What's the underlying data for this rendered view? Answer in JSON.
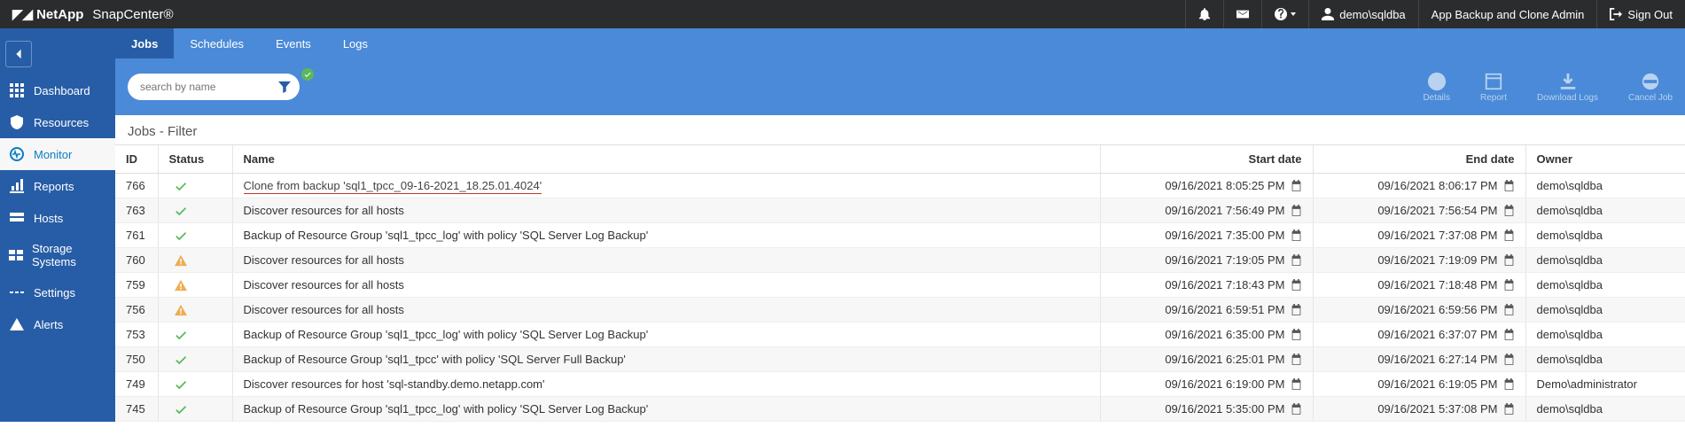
{
  "header": {
    "brand_bold": "NetApp",
    "product": "SnapCenter®",
    "user": "demo\\sqldba",
    "role": "App Backup and Clone Admin",
    "signout": "Sign Out"
  },
  "sidebar": {
    "items": [
      {
        "label": "Dashboard"
      },
      {
        "label": "Resources"
      },
      {
        "label": "Monitor"
      },
      {
        "label": "Reports"
      },
      {
        "label": "Hosts"
      },
      {
        "label": "Storage Systems"
      },
      {
        "label": "Settings"
      },
      {
        "label": "Alerts"
      }
    ]
  },
  "tabs": [
    {
      "label": "Jobs"
    },
    {
      "label": "Schedules"
    },
    {
      "label": "Events"
    },
    {
      "label": "Logs"
    }
  ],
  "search": {
    "placeholder": "search by name"
  },
  "toolbar_actions": [
    {
      "label": "Details"
    },
    {
      "label": "Report"
    },
    {
      "label": "Download Logs"
    },
    {
      "label": "Cancel Job"
    }
  ],
  "filter_title": "Jobs - Filter",
  "columns": {
    "id": "ID",
    "status": "Status",
    "name": "Name",
    "start": "Start date",
    "end": "End date",
    "owner": "Owner"
  },
  "rows": [
    {
      "id": "766",
      "status": "ok",
      "name": "Clone from backup 'sql1_tpcc_09-16-2021_18.25.01.4024'",
      "start": "09/16/2021 8:05:25 PM",
      "end": "09/16/2021 8:06:17 PM",
      "owner": "demo\\sqldba",
      "hl": true
    },
    {
      "id": "763",
      "status": "ok",
      "name": "Discover resources for all hosts",
      "start": "09/16/2021 7:56:49 PM",
      "end": "09/16/2021 7:56:54 PM",
      "owner": "demo\\sqldba"
    },
    {
      "id": "761",
      "status": "ok",
      "name": "Backup of Resource Group 'sql1_tpcc_log' with policy 'SQL Server Log Backup'",
      "start": "09/16/2021 7:35:00 PM",
      "end": "09/16/2021 7:37:08 PM",
      "owner": "demo\\sqldba"
    },
    {
      "id": "760",
      "status": "warn",
      "name": "Discover resources for all hosts",
      "start": "09/16/2021 7:19:05 PM",
      "end": "09/16/2021 7:19:09 PM",
      "owner": "demo\\sqldba"
    },
    {
      "id": "759",
      "status": "warn",
      "name": "Discover resources for all hosts",
      "start": "09/16/2021 7:18:43 PM",
      "end": "09/16/2021 7:18:48 PM",
      "owner": "demo\\sqldba"
    },
    {
      "id": "756",
      "status": "warn",
      "name": "Discover resources for all hosts",
      "start": "09/16/2021 6:59:51 PM",
      "end": "09/16/2021 6:59:56 PM",
      "owner": "demo\\sqldba"
    },
    {
      "id": "753",
      "status": "ok",
      "name": "Backup of Resource Group 'sql1_tpcc_log' with policy 'SQL Server Log Backup'",
      "start": "09/16/2021 6:35:00 PM",
      "end": "09/16/2021 6:37:07 PM",
      "owner": "demo\\sqldba"
    },
    {
      "id": "750",
      "status": "ok",
      "name": "Backup of Resource Group 'sql1_tpcc' with policy 'SQL Server Full Backup'",
      "start": "09/16/2021 6:25:01 PM",
      "end": "09/16/2021 6:27:14 PM",
      "owner": "demo\\sqldba"
    },
    {
      "id": "749",
      "status": "ok",
      "name": "Discover resources for host 'sql-standby.demo.netapp.com'",
      "start": "09/16/2021 6:19:00 PM",
      "end": "09/16/2021 6:19:05 PM",
      "owner": "Demo\\administrator"
    },
    {
      "id": "745",
      "status": "ok",
      "name": "Backup of Resource Group 'sql1_tpcc_log' with policy 'SQL Server Log Backup'",
      "start": "09/16/2021 5:35:00 PM",
      "end": "09/16/2021 5:37:08 PM",
      "owner": "demo\\sqldba"
    }
  ]
}
